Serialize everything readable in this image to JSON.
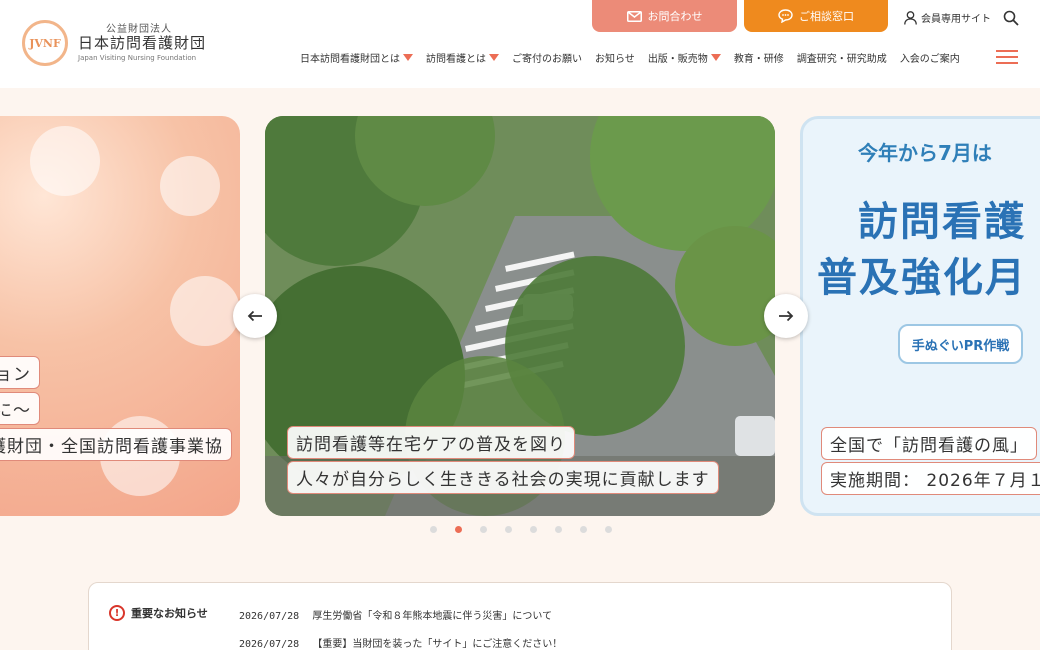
{
  "header": {
    "logo_mark": "JVNF",
    "logo_sub": "公益財団法人",
    "logo_main": "日本訪問看護財団",
    "logo_en": "Japan Visiting Nursing Foundation",
    "contact_label": "お問合わせ",
    "consult_label": "ご相談窓口",
    "member_label": "会員専用サイト"
  },
  "nav": {
    "items": [
      {
        "label": "日本訪問看護財団とは",
        "caret": true
      },
      {
        "label": "訪問看護とは",
        "caret": true
      },
      {
        "label": "ご寄付のお願い",
        "caret": false
      },
      {
        "label": "お知らせ",
        "caret": false
      },
      {
        "label": "出版・販売物",
        "caret": true
      },
      {
        "label": "教育・研修",
        "caret": false
      },
      {
        "label": "調査研究・研究助成",
        "caret": false
      },
      {
        "label": "入会のご案内",
        "caret": false
      }
    ]
  },
  "slider": {
    "left_captions": [
      "ビジョン",
      "ために〜",
      "護財団・全国訪問看護事業協"
    ],
    "center_captions": [
      "訪問看護等在宅ケアの普及を図り",
      "人々が自分らしく生ききる社会の実現に貢献します"
    ],
    "right_title_1": "今年から7月は",
    "right_title_2": "訪問看護",
    "right_title_3": "普及強化月",
    "right_badge": "手ぬぐいPR作戦",
    "right_captions": [
      "全国で「訪問看護の風」",
      "実施期間： 2026年７月１"
    ],
    "dot_count": 8,
    "active_dot": 1
  },
  "notice": {
    "label": "重要なお知らせ",
    "items": [
      {
        "date": "2026/07/28",
        "text": "厚生労働省「令和８年熊本地震に伴う災害」について"
      },
      {
        "date": "2026/07/28",
        "text": "【重要】当財団を装った「サイト」にご注意ください！"
      }
    ]
  },
  "colors": {
    "accent": "#ec6d55",
    "contact_bg": "#ec8b78",
    "consult_bg": "#ef8a1e",
    "page_bg": "#fdf5ef"
  }
}
